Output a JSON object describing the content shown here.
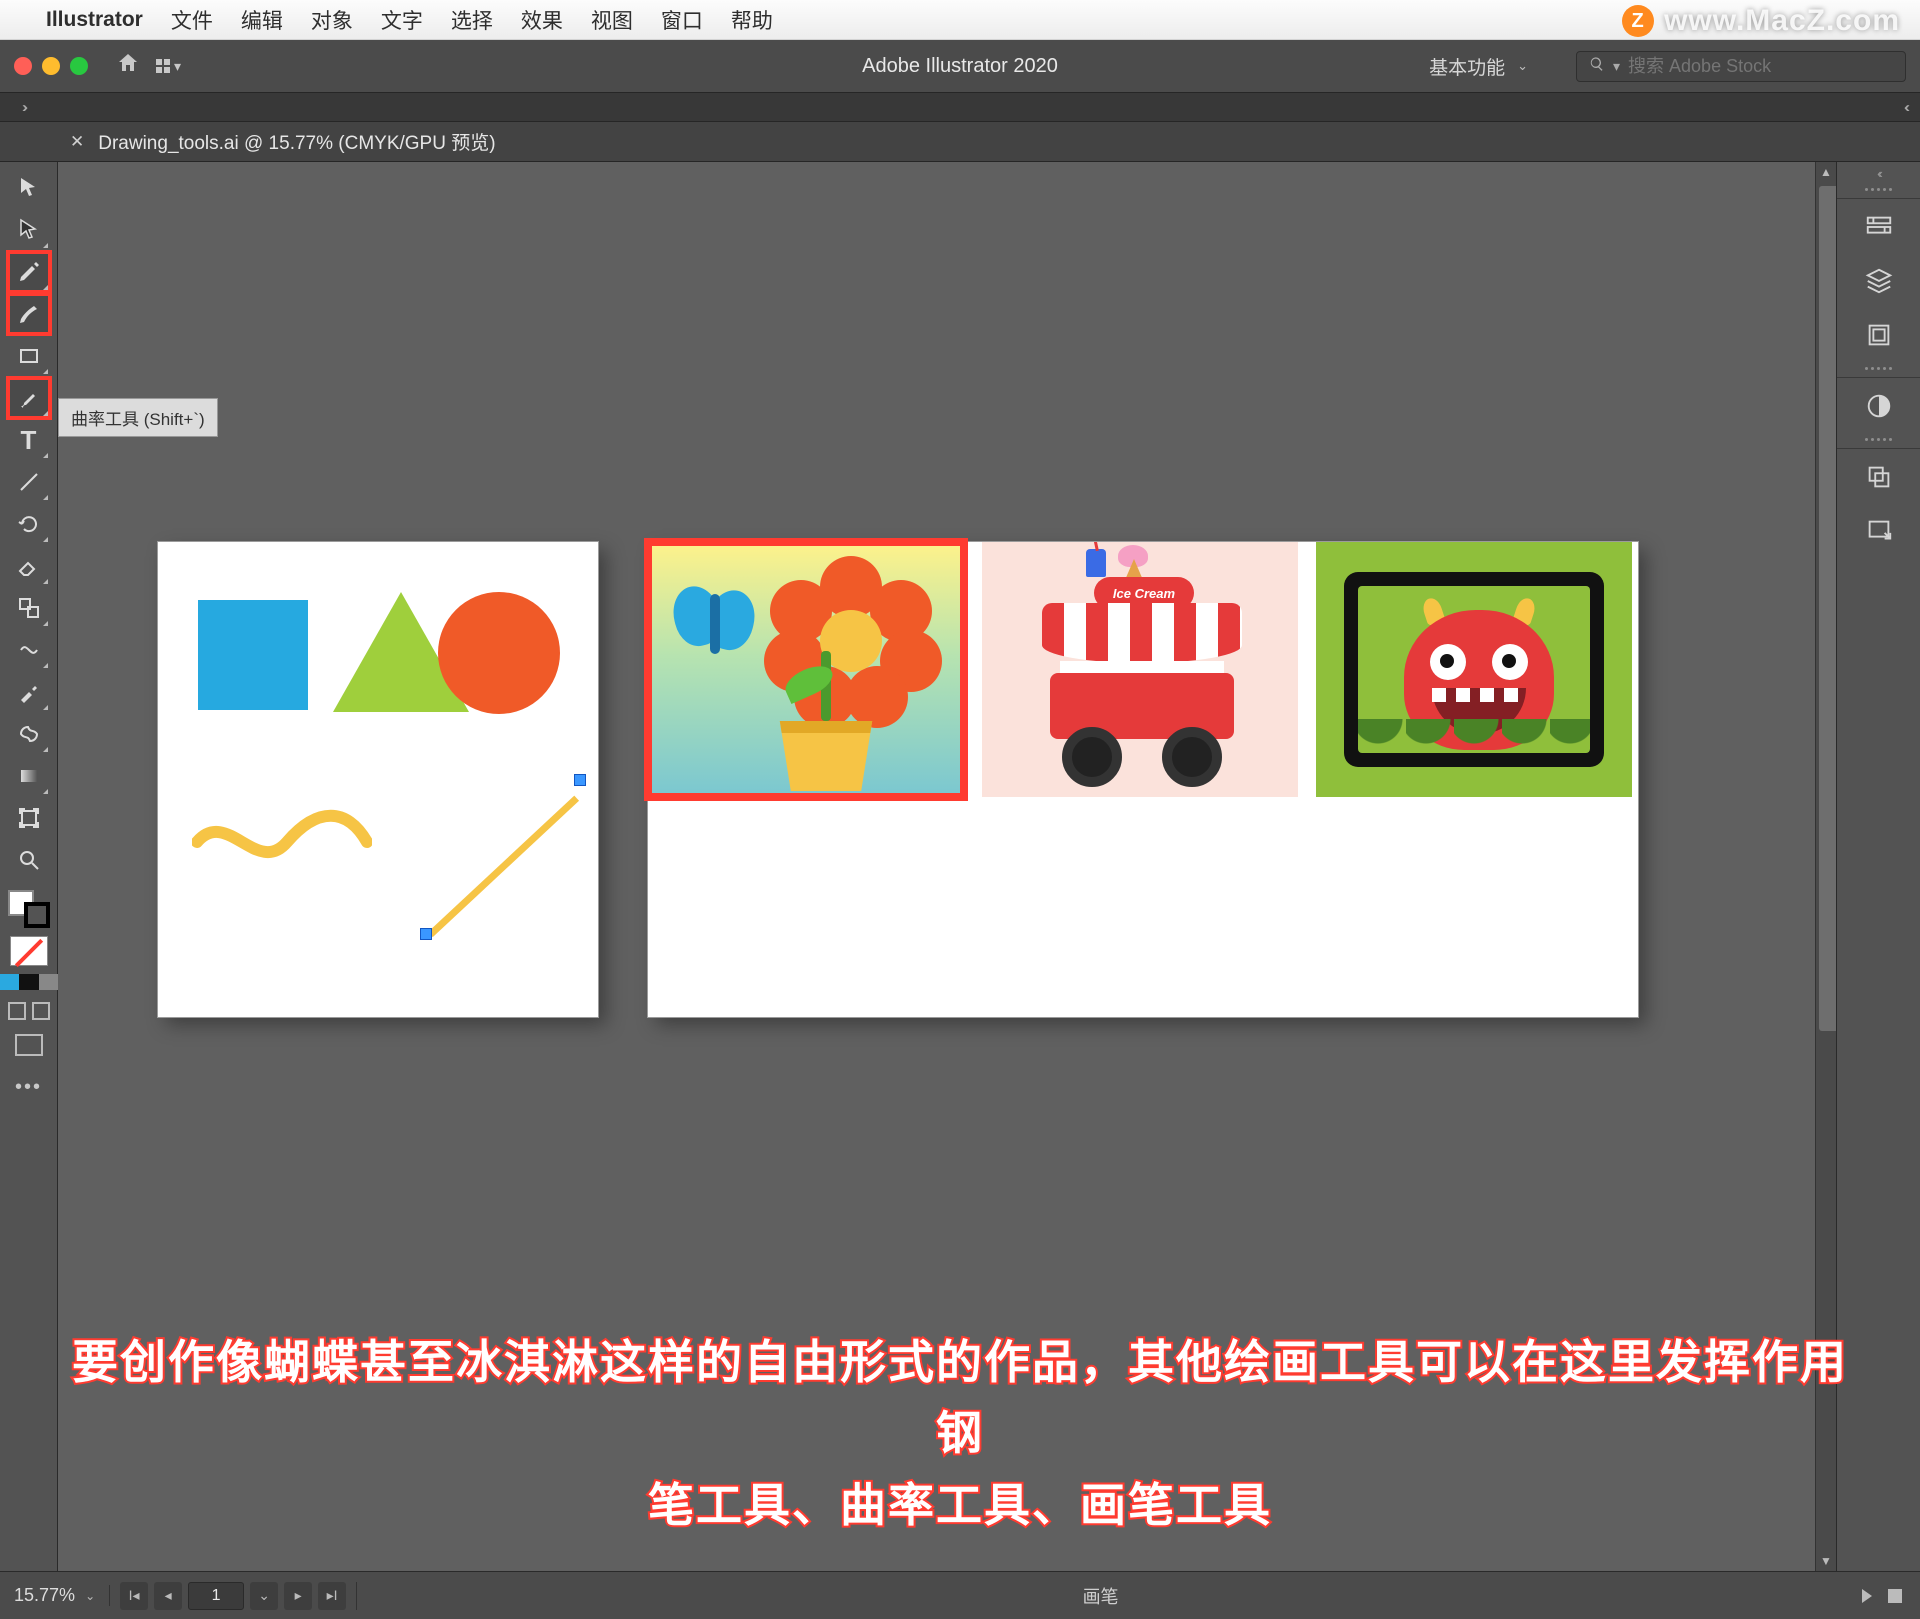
{
  "mac_menubar": {
    "app_name": "Illustrator",
    "items": [
      "文件",
      "编辑",
      "对象",
      "文字",
      "选择",
      "效果",
      "视图",
      "窗口",
      "帮助"
    ]
  },
  "watermark": {
    "badge": "Z",
    "text": "www.MacZ.com"
  },
  "app_titlebar": {
    "title": "Adobe Illustrator 2020",
    "workspace_label": "基本功能",
    "search_placeholder": "搜索 Adobe Stock"
  },
  "document_tab": {
    "label": "Drawing_tools.ai @ 15.77% (CMYK/GPU 预览)"
  },
  "tooltip": {
    "text": "曲率工具 (Shift+`)"
  },
  "artboards": {
    "thumb_icecream_sign": "Ice Cream"
  },
  "subtitle": {
    "line1": "要创作像蝴蝶甚至冰淇淋这样的自由形式的作品，其他绘画工具可以在这里发挥作用钢",
    "line2": "笔工具、曲率工具、画笔工具"
  },
  "statusbar": {
    "zoom": "15.77%",
    "artboard_index": "1",
    "panel_label": "画笔"
  },
  "left_toolbar": {
    "tools": [
      "selection-tool",
      "direct-selection-tool",
      "pen-tool",
      "curvature-tool",
      "rectangle-tool",
      "paintbrush-tool",
      "type-tool",
      "line-tool",
      "rotate-tool",
      "eraser-tool",
      "scale-tool",
      "width-tool",
      "eyedropper-tool",
      "blend-tool",
      "gradient-tool",
      "artboard-tool",
      "zoom-tool"
    ]
  },
  "right_dock": {
    "panels": [
      "properties",
      "layers",
      "libraries",
      "appearance",
      "artboards",
      "export"
    ]
  }
}
